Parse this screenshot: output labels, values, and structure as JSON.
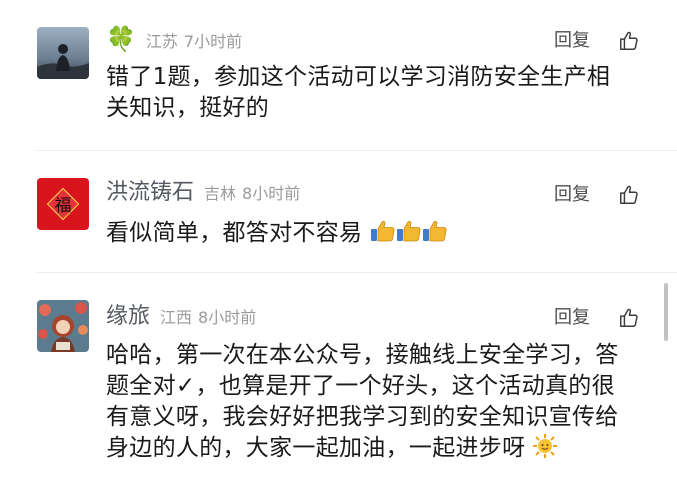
{
  "comments": [
    {
      "name_emoji": "🍀",
      "name": "",
      "location": "江苏",
      "time": "7小时前",
      "reply_label": "回复",
      "text_lines": [
        "错了1题，参加这个活动可以学习消防安全生产相",
        "关知识，挺好的"
      ]
    },
    {
      "name": "洪流铸石",
      "location": "吉林",
      "time": "8小时前",
      "reply_label": "回复",
      "text": "看似简单，都答对不容易",
      "text_emoji": [
        "thumbs-up",
        "thumbs-up",
        "thumbs-up"
      ]
    },
    {
      "name": "缘旅",
      "location": "江西",
      "time": "8小时前",
      "reply_label": "回复",
      "text_lines": [
        "哈哈，第一次在本公众号，接触线上安全学习，答",
        "题全对✓，也算是开了一个好头，这个活动真的很",
        "有意义呀，我会好好把我学习到的安全知识宣传给",
        "身边的人的，大家一起加油，一起进步呀"
      ],
      "text_emoji_end": "sun-face"
    }
  ],
  "avatar_badge": "福",
  "colors": {
    "meta": "#9b9b9b",
    "name": "#555a60",
    "text": "#1a1a1a",
    "thumb": "#f3b731",
    "avatar_red": "#d8141c"
  },
  "icons": [
    "clover",
    "thumbs-up-outline-icon",
    "thumbs-up-emoji",
    "sun-emoji"
  ]
}
